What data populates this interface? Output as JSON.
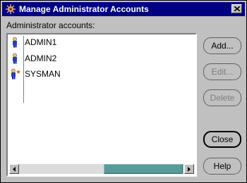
{
  "window": {
    "title": "Manage Administrator Accounts",
    "close_glyph": "x"
  },
  "list": {
    "label": "Administrator accounts:",
    "items": [
      {
        "label": "ADMIN1",
        "icon": "admin-user-icon"
      },
      {
        "label": "ADMIN2",
        "icon": "admin-user-icon"
      },
      {
        "label": "SYSMAN",
        "icon": "super-admin-user-icon"
      }
    ]
  },
  "buttons": {
    "add": "Add...",
    "edit": "Edit...",
    "delete": "Delete",
    "close": "Close",
    "help": "Help"
  },
  "colors": {
    "titlebar": "#000080",
    "face": "#c0c0c0",
    "scroll_thumb": "#5a9a9a"
  }
}
